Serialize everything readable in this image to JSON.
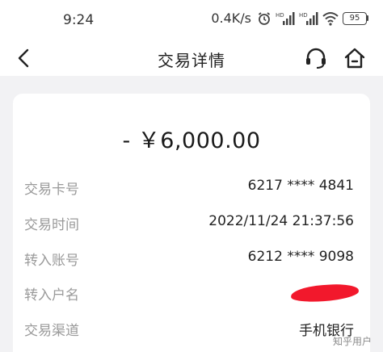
{
  "status_bar": {
    "time": "9:24",
    "net_speed": "0.4K/s",
    "signal_tag": "HD",
    "battery": "95"
  },
  "nav": {
    "title": "交易详情"
  },
  "transaction": {
    "amount": "- ￥6,000.00",
    "rows": [
      {
        "label": "交易卡号",
        "value": "6217 **** 4841"
      },
      {
        "label": "交易时间",
        "value": "2022/11/24 21:37:56"
      },
      {
        "label": "转入账号",
        "value": "6212 **** 9098"
      },
      {
        "label": "转入户名",
        "value": ""
      },
      {
        "label": "交易渠道",
        "value": "手机银行"
      }
    ]
  },
  "watermark": "知乎用户",
  "colors": {
    "background": "#f2f2f4",
    "card": "#ffffff",
    "label": "#9a9a9a",
    "redaction": "#f2182c"
  }
}
